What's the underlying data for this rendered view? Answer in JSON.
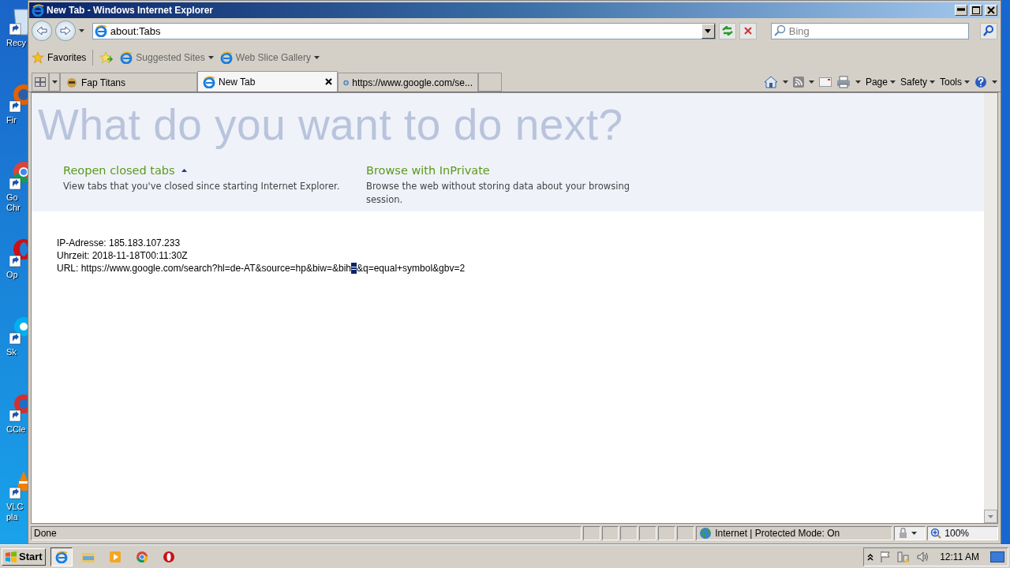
{
  "desktop_icons": [
    {
      "kind": "recycle",
      "lines": [
        "Recy"
      ]
    },
    {
      "kind": "firefox",
      "lines": [
        "Fir"
      ]
    },
    {
      "kind": "chrome",
      "lines": [
        "Go",
        "Chr"
      ]
    },
    {
      "kind": "opera",
      "lines": [
        "Op"
      ]
    },
    {
      "kind": "skype",
      "lines": [
        "Sk"
      ]
    },
    {
      "kind": "ccleaner",
      "lines": [
        "CCle"
      ]
    },
    {
      "kind": "vlc",
      "lines": [
        "VLC",
        "pla"
      ]
    }
  ],
  "window": {
    "title": "New Tab - Windows Internet Explorer"
  },
  "address_bar": {
    "value": "about:Tabs"
  },
  "search": {
    "placeholder": "Bing"
  },
  "favorites_bar": {
    "favorites": "Favorites",
    "links": [
      "Suggested Sites",
      "Web Slice Gallery"
    ]
  },
  "tabs": [
    {
      "kind": "game",
      "label": "Fap Titans",
      "selected": false
    },
    {
      "kind": "ie",
      "label": "New Tab",
      "selected": true
    },
    {
      "kind": "google",
      "label": "https://www.google.com/se...",
      "selected": false
    }
  ],
  "command_bar": [
    "Page",
    "Safety",
    "Tools"
  ],
  "new_tab_page": {
    "heading": "What do you want to do next?",
    "options": [
      {
        "title": "Reopen closed tabs",
        "description": "View tabs that you've closed since starting Internet Explorer.",
        "expanded": true
      },
      {
        "title": "Browse with InPrivate",
        "description": "Browse the web without storing data about your browsing session."
      }
    ]
  },
  "page_text": {
    "lines": [
      {
        "text": "IP-Adresse: 185.183.107.233"
      },
      {
        "text": "Uhrzeit: 2018-11-18T00:11:30Z"
      },
      {
        "text": "URL: https://www.google.com/search?hl=de-AT&source=hp&biw=&bih",
        "selected_text": "=",
        "text_after": "&q=equal+symbol&gbv=2"
      }
    ]
  },
  "status_bar": {
    "status": "Done",
    "zone": "Internet | Protected Mode: On",
    "zoom": "100%"
  },
  "taskbar": {
    "start": "Start",
    "apps": [
      {
        "kind": "ie",
        "selected": true
      },
      {
        "kind": "explorer",
        "selected": false
      },
      {
        "kind": "media",
        "selected": false
      },
      {
        "kind": "chrome",
        "selected": false
      },
      {
        "kind": "opera",
        "selected": false
      }
    ],
    "clock": "12:11 AM"
  }
}
